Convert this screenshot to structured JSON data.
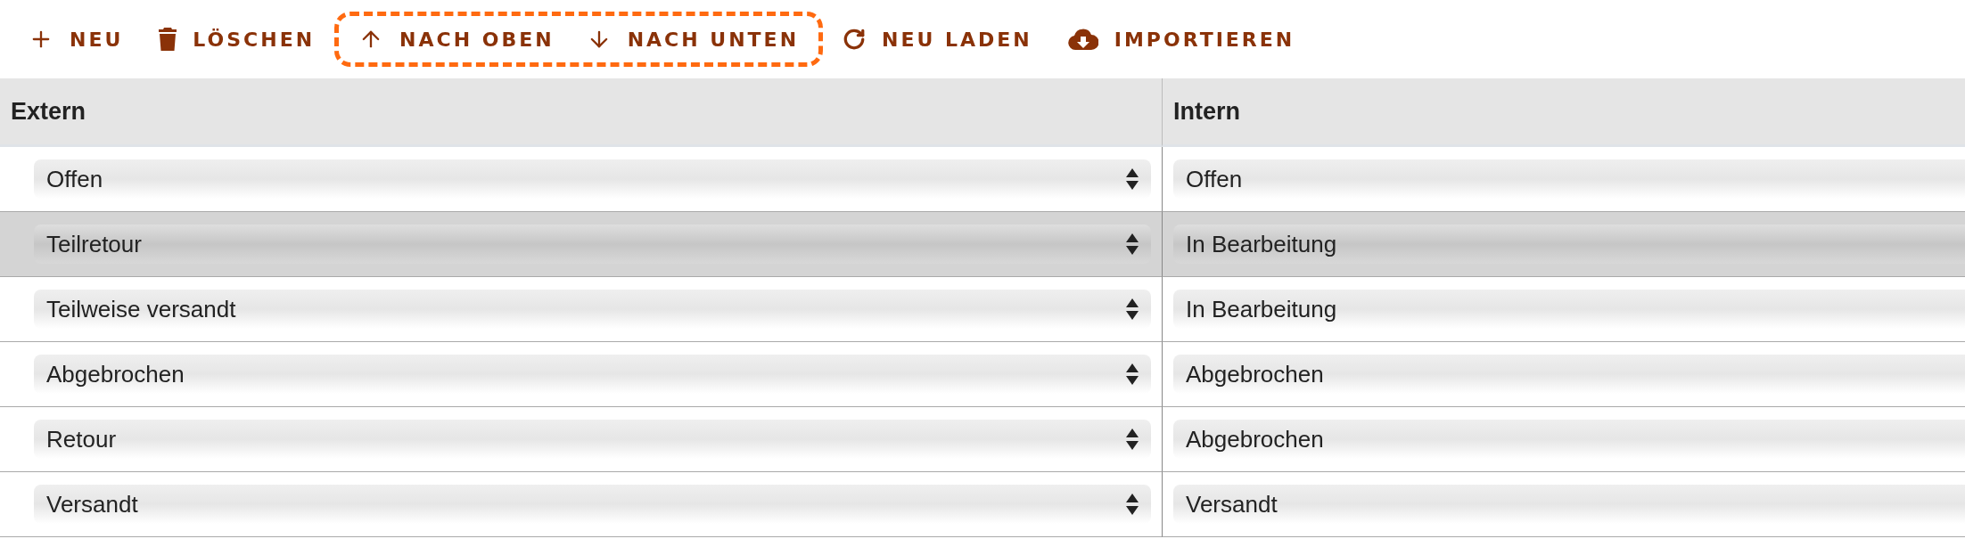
{
  "toolbar": [
    {
      "kind": "new",
      "label": "NEU",
      "highlighted": false
    },
    {
      "kind": "delete",
      "label": "LÖSCHEN",
      "highlighted": false
    },
    {
      "kind": "up",
      "label": "NACH OBEN",
      "highlighted": true
    },
    {
      "kind": "down",
      "label": "NACH UNTEN",
      "highlighted": true
    },
    {
      "kind": "reload",
      "label": "NEU LADEN",
      "highlighted": false
    },
    {
      "kind": "import",
      "label": "IMPORTIEREN",
      "highlighted": false
    }
  ],
  "table": {
    "columns": [
      "Extern",
      "Intern"
    ],
    "rows": [
      {
        "selected": false,
        "extern": "Offen",
        "intern": "Offen"
      },
      {
        "selected": true,
        "extern": "Teilretour",
        "intern": "In Bearbeitung"
      },
      {
        "selected": false,
        "extern": "Teilweise versandt",
        "intern": "In Bearbeitung"
      },
      {
        "selected": false,
        "extern": "Abgebrochen",
        "intern": "Abgebrochen"
      },
      {
        "selected": false,
        "extern": "Retour",
        "intern": "Abgebrochen"
      },
      {
        "selected": false,
        "extern": "Versandt",
        "intern": "Versandt"
      }
    ]
  }
}
